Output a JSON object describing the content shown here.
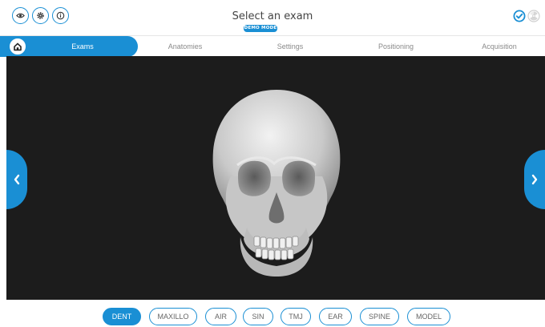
{
  "header": {
    "title": "Select an exam",
    "badge": "DEMO MODE",
    "left_icons": [
      "eye-icon",
      "gear-icon",
      "info-icon"
    ],
    "right_icons": [
      "check-circle-icon",
      "radiation-icon"
    ]
  },
  "nav": {
    "home_icon": "home-icon",
    "tabs": [
      {
        "label": "Exams",
        "active": true
      },
      {
        "label": "Anatomies",
        "active": false
      },
      {
        "label": "Settings",
        "active": false
      },
      {
        "label": "Positioning",
        "active": false
      },
      {
        "label": "Acquisition",
        "active": false
      }
    ]
  },
  "viewer": {
    "content": "skull-3d-model",
    "left_arrow_icon": "chevron-left-icon",
    "right_arrow_icon": "chevron-right-icon"
  },
  "exams": [
    {
      "label": "DENT",
      "active": true
    },
    {
      "label": "MAXILLO",
      "active": false
    },
    {
      "label": "AIR",
      "active": false
    },
    {
      "label": "SIN",
      "active": false
    },
    {
      "label": "TMJ",
      "active": false
    },
    {
      "label": "EAR",
      "active": false
    },
    {
      "label": "SPINE",
      "active": false
    },
    {
      "label": "MODEL",
      "active": false
    }
  ],
  "colors": {
    "accent": "#1a8fd4",
    "viewer_bg": "#1c1c1c",
    "inactive_text": "#8a8a8a"
  }
}
